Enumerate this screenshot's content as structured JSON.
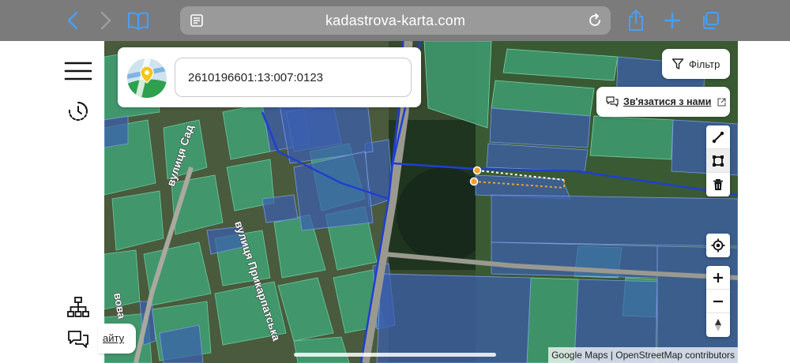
{
  "browser": {
    "url": "kadastrova-karta.com"
  },
  "search": {
    "value": "2610196601:13:007:0123"
  },
  "toolbar": {
    "filter_label": "Фільтр",
    "contact_label": "Зв'язатися з нами"
  },
  "map": {
    "streets": [
      "вулиця Сад",
      "вулиця Прикарпатська",
      "вова"
    ],
    "attribution": "Google Maps | OpenStreetMap contributors"
  },
  "footer": {
    "site_label": "айту"
  },
  "icons": {
    "back": "chevron-left-icon",
    "forward": "chevron-right-icon",
    "bookmarks": "book-icon",
    "reader": "reader-icon",
    "reload": "reload-icon",
    "share": "share-icon",
    "new_tab": "plus-icon",
    "tabs": "tabs-icon",
    "menu": "hamburger-icon",
    "history": "history-icon",
    "structure": "hierarchy-icon",
    "chat": "chat-icon",
    "filter": "filter-icon",
    "external": "external-link-icon",
    "line_tool": "line-draw-icon",
    "polygon_tool": "polygon-draw-icon",
    "delete_tool": "trash-icon",
    "locate": "locate-icon",
    "zoom_in": "zoom-in-icon",
    "zoom_out": "zoom-out-icon",
    "compass": "compass-icon"
  },
  "colors": {
    "chrome": "#7b7b7b",
    "accent_blue": "#4a90d9",
    "parcel_green": "#3fa77a",
    "parcel_blue": "#3b5fb0",
    "boundary": "#1f3fd1",
    "measure_orange": "#f0a030"
  }
}
